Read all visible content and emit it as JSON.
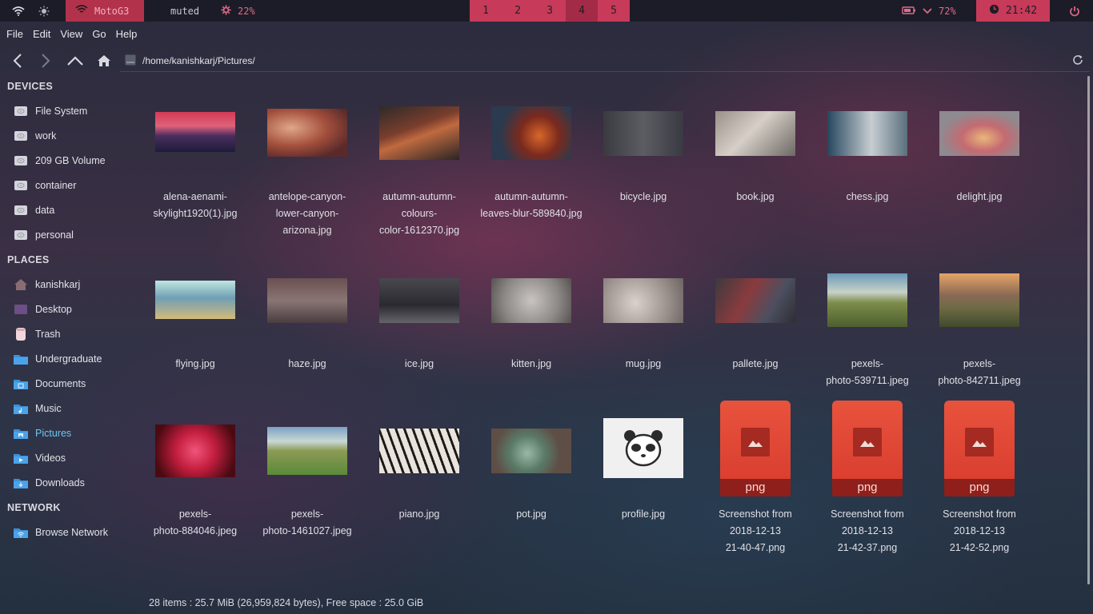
{
  "panel": {
    "network": "MotoG3",
    "volume": "muted",
    "cpu": "22%",
    "workspaces": [
      "1",
      "2",
      "3",
      "4",
      "5"
    ],
    "active_workspace": "4",
    "battery": "72%",
    "time": "21:42"
  },
  "menu": [
    "File",
    "Edit",
    "View",
    "Go",
    "Help"
  ],
  "location": "/home/kanishkarj/Pictures/",
  "sidebar": {
    "devices_title": "DEVICES",
    "devices": [
      "File System",
      "work",
      "209 GB Volume",
      "container",
      "data",
      "personal"
    ],
    "places_title": "PLACES",
    "places": [
      {
        "label": "kanishkarj",
        "icon": "home-icon"
      },
      {
        "label": "Desktop",
        "icon": "desktop-icon"
      },
      {
        "label": "Trash",
        "icon": "trash-icon"
      },
      {
        "label": "Undergraduate",
        "icon": "folder-icon"
      },
      {
        "label": "Documents",
        "icon": "documents-folder-icon"
      },
      {
        "label": "Music",
        "icon": "music-folder-icon"
      },
      {
        "label": "Pictures",
        "icon": "pictures-folder-icon"
      },
      {
        "label": "Videos",
        "icon": "videos-folder-icon"
      },
      {
        "label": "Downloads",
        "icon": "downloads-folder-icon"
      }
    ],
    "network_title": "NETWORK",
    "network": [
      "Browse Network"
    ]
  },
  "files": [
    {
      "name": "alena-aenami-skylight1920(1).jpg",
      "lines": [
        "alena-aenami-",
        "skylight1920(1).jpg"
      ]
    },
    {
      "name": "antelope-canyon-lower-canyon-arizona.jpg",
      "lines": [
        "antelope-canyon-",
        "lower-canyon-",
        "arizona.jpg"
      ]
    },
    {
      "name": "autumn-autumn-colours-color-1612370.jpg",
      "lines": [
        "autumn-autumn-",
        "colours-",
        "color-1612370.jpg"
      ]
    },
    {
      "name": "autumn-autumn-leaves-blur-589840.jpg",
      "lines": [
        "autumn-autumn-",
        "leaves-blur-589840.jpg"
      ]
    },
    {
      "name": "bicycle.jpg",
      "lines": [
        "bicycle.jpg"
      ]
    },
    {
      "name": "book.jpg",
      "lines": [
        "book.jpg"
      ]
    },
    {
      "name": "chess.jpg",
      "lines": [
        "chess.jpg"
      ]
    },
    {
      "name": "delight.jpg",
      "lines": [
        "delight.jpg"
      ]
    },
    {
      "name": "flying.jpg",
      "lines": [
        "flying.jpg"
      ]
    },
    {
      "name": "haze.jpg",
      "lines": [
        "haze.jpg"
      ]
    },
    {
      "name": "ice.jpg",
      "lines": [
        "ice.jpg"
      ]
    },
    {
      "name": "kitten.jpg",
      "lines": [
        "kitten.jpg"
      ]
    },
    {
      "name": "mug.jpg",
      "lines": [
        "mug.jpg"
      ]
    },
    {
      "name": "pallete.jpg",
      "lines": [
        "pallete.jpg"
      ]
    },
    {
      "name": "pexels-photo-539711.jpeg",
      "lines": [
        "pexels-",
        "photo-539711.jpeg"
      ]
    },
    {
      "name": "pexels-photo-842711.jpeg",
      "lines": [
        "pexels-",
        "photo-842711.jpeg"
      ]
    },
    {
      "name": "pexels-photo-884046.jpeg",
      "lines": [
        "pexels-",
        "photo-884046.jpeg"
      ]
    },
    {
      "name": "pexels-photo-1461027.jpeg",
      "lines": [
        "pexels-",
        "photo-1461027.jpeg"
      ]
    },
    {
      "name": "piano.jpg",
      "lines": [
        "piano.jpg"
      ]
    },
    {
      "name": "pot.jpg",
      "lines": [
        "pot.jpg"
      ]
    },
    {
      "name": "profile.jpg",
      "lines": [
        "profile.jpg"
      ]
    },
    {
      "name": "Screenshot from 2018-12-13 21-40-47.png",
      "lines": [
        "Screenshot from",
        "2018-12-13",
        "21-40-47.png"
      ],
      "badge": "png"
    },
    {
      "name": "Screenshot from 2018-12-13 21-42-37.png",
      "lines": [
        "Screenshot from",
        "2018-12-13",
        "21-42-37.png"
      ],
      "badge": "png"
    },
    {
      "name": "Screenshot from 2018-12-13 21-42-52.png",
      "lines": [
        "Screenshot from",
        "2018-12-13",
        "21-42-52.png"
      ],
      "badge": "png"
    }
  ],
  "status": "28 items : 25.7 MiB (26,959,824 bytes), Free space : 25.0 GiB"
}
